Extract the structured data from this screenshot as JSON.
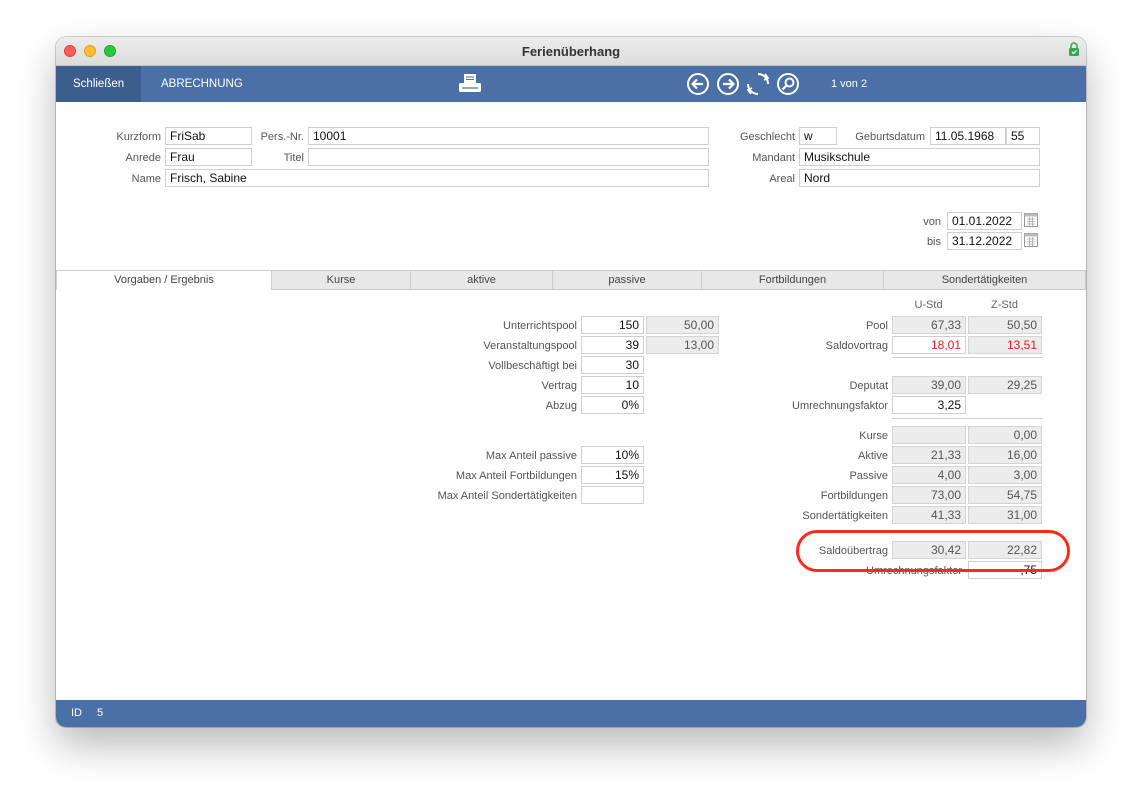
{
  "window": {
    "title": "Ferienüberhang"
  },
  "toolbar": {
    "close_label": "Schließen",
    "billing_label": "ABRECHNUNG",
    "record_position": "1 von 2"
  },
  "header": {
    "kurzform_label": "Kurzform",
    "kurzform": "FriSab",
    "persnr_label": "Pers.-Nr.",
    "persnr": "10001",
    "anrede_label": "Anrede",
    "anrede": "Frau",
    "titel_label": "Titel",
    "titel": "",
    "name_label": "Name",
    "name": "Frisch, Sabine",
    "geschlecht_label": "Geschlecht",
    "geschlecht": "w",
    "geburtsdatum_label": "Geburtsdatum",
    "geburtsdatum": "11.05.1968",
    "alter": "55",
    "mandant_label": "Mandant",
    "mandant": "Musikschule",
    "areal_label": "Areal",
    "areal": "Nord",
    "von_label": "von",
    "von": "01.01.2022",
    "bis_label": "bis",
    "bis": "31.12.2022"
  },
  "tabs": [
    "Vorgaben / Ergebnis",
    "Kurse",
    "aktive",
    "passive",
    "Fortbildungen",
    "Sondertätigkeiten"
  ],
  "left": {
    "unterrichtspool_label": "Unterrichtspool",
    "unterrichtspool": "150",
    "unterrichtspool_calc": "50,00",
    "veranstaltungspool_label": "Veranstaltungspool",
    "veranstaltungspool": "39",
    "veranstaltungspool_calc": "13,00",
    "vollbeschaeftigt_label": "Vollbeschäftigt bei",
    "vollbeschaeftigt": "30",
    "vertrag_label": "Vertrag",
    "vertrag": "10",
    "abzug_label": "Abzug",
    "abzug": "0%",
    "max_passive_label": "Max Anteil passive",
    "max_passive": "10%",
    "max_fortbildungen_label": "Max Anteil Fortbildungen",
    "max_fortbildungen": "15%",
    "max_sonder_label": "Max Anteil Sondertätigkeiten",
    "max_sonder": ""
  },
  "right": {
    "col_u": "U-Std",
    "col_z": "Z-Std",
    "pool_label": "Pool",
    "pool_u": "67,33",
    "pool_z": "50,50",
    "saldovortrag_label": "Saldovortrag",
    "saldovortrag_u": "18,01",
    "saldovortrag_z": "13,51",
    "deputat_label": "Deputat",
    "deputat_u": "39,00",
    "deputat_z": "29,25",
    "umrechnung_label": "Umrechnungsfaktor",
    "umrechnung": "3,25",
    "kurse_label": "Kurse",
    "kurse_u": "",
    "kurse_z": "0,00",
    "aktive_label": "Aktive",
    "aktive_u": "21,33",
    "aktive_z": "16,00",
    "passive_label": "Passive",
    "passive_u": "4,00",
    "passive_z": "3,00",
    "fortbildungen_label": "Fortbildungen",
    "fortbildungen_u": "73,00",
    "fortbildungen_z": "54,75",
    "sonder_label": "Sondertätigkeiten",
    "sonder_u": "41,33",
    "sonder_z": "31,00",
    "saldouebertrag_label": "Saldoübertrag",
    "saldouebertrag_u": "30,42",
    "saldouebertrag_z": "22,82",
    "umrechnung2_label": "Umrechnungsfaktor",
    "umrechnung2": ",75"
  },
  "status": {
    "id_label": "ID",
    "id": "5"
  },
  "colors": {
    "accent": "#4a70a7",
    "negative": "#e02020",
    "highlight": "#ff2a1a"
  },
  "icons": [
    "lock-icon",
    "printer-icon",
    "arrow-left-icon",
    "arrow-right-icon",
    "refresh-icon",
    "search-icon",
    "calendar-icon"
  ]
}
